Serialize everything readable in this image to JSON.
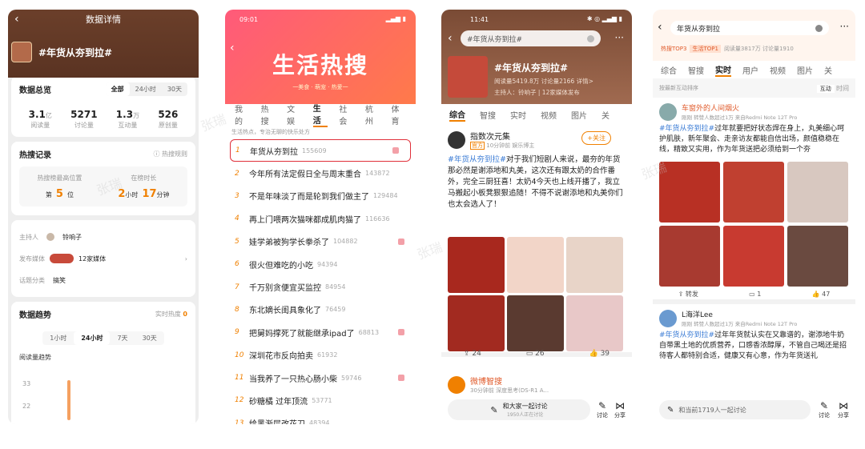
{
  "panel1": {
    "title": "数据详情",
    "topic": "#年货从夯到拉#",
    "overview": {
      "label": "数据总览",
      "segments": [
        "全部",
        "24小时",
        "30天"
      ],
      "stats": [
        {
          "value": "3.1",
          "unit": "亿",
          "label": "阅读量"
        },
        {
          "value": "5271",
          "unit": "",
          "label": "讨论量"
        },
        {
          "value": "1.3",
          "unit": "万",
          "label": "互动量"
        },
        {
          "value": "526",
          "unit": "",
          "label": "原创量"
        }
      ]
    },
    "hot_record": {
      "label": "热搜记录",
      "rule": "热搜规则",
      "rank_label": "热搜榜最高位置",
      "rank_prefix": "第",
      "rank_value": "5",
      "rank_suffix": "位",
      "duration_label": "在榜时长",
      "hours": "2",
      "hours_unit": "小时",
      "minutes": "17",
      "minutes_unit": "分钟"
    },
    "host_label": "主持人",
    "host_name": "铃响子",
    "media_label": "发布媒体",
    "media_value": "12家媒体",
    "category_label": "话题分类",
    "category_value": "搞笑",
    "trend": {
      "label": "数据趋势",
      "realtime": "实时热度",
      "realtime_value": "0",
      "segments": [
        "1小时",
        "24小时",
        "7天",
        "30天"
      ],
      "chart_label": "阅读量趋势",
      "y_ticks": [
        "33",
        "22"
      ]
    }
  },
  "panel2": {
    "time": "09:01",
    "banner_title": "生活热搜",
    "banner_sub": "一美食 · 萌宠 · 热爱一",
    "tabs": [
      "我的",
      "热搜",
      "文娱",
      "生活",
      "社会",
      "杭州",
      "体育"
    ],
    "active_tab": 3,
    "subtitle": "生活热点，专治无聊的快乐处方",
    "items": [
      {
        "rank": "1",
        "title": "年货从夯到拉",
        "heat": "155609",
        "tag": true
      },
      {
        "rank": "2",
        "title": "今年所有法定假日全与周末重合",
        "heat": "143872",
        "tag": false
      },
      {
        "rank": "3",
        "title": "不是年味淡了而是轮到我们做主了",
        "heat": "129484",
        "tag": false
      },
      {
        "rank": "4",
        "title": "再上门喂两次猫咪都成肌肉猫了",
        "heat": "116636",
        "tag": false
      },
      {
        "rank": "5",
        "title": "娃学弟被狗学长拳杀了",
        "heat": "104882",
        "tag": true
      },
      {
        "rank": "6",
        "title": "很火但难吃的小吃",
        "heat": "94394",
        "tag": false
      },
      {
        "rank": "7",
        "title": "千万别贪便宜买监控",
        "heat": "84954",
        "tag": false
      },
      {
        "rank": "8",
        "title": "东北嫡长闺具象化了",
        "heat": "76459",
        "tag": false
      },
      {
        "rank": "9",
        "title": "把舅妈撑死了就能继承ipad了",
        "heat": "68813",
        "tag": true
      },
      {
        "rank": "10",
        "title": "深圳花市反向拍卖",
        "heat": "61932",
        "tag": false
      },
      {
        "rank": "11",
        "title": "当我养了一只热心肠小柴",
        "heat": "59746",
        "tag": true
      },
      {
        "rank": "12",
        "title": "砂糖橘 过年顶流",
        "heat": "53771",
        "tag": false
      },
      {
        "rank": "13",
        "title": "给黑渐层改花刀",
        "heat": "48394",
        "tag": false
      }
    ]
  },
  "panel3": {
    "time": "11:41",
    "search_value": "#年货从夯到拉#",
    "topic": "#年货从夯到拉#",
    "meta1": "阅读量5419.8万  讨论量2166  详情>",
    "meta2": "主持人：铃响子 | 12家媒体发布",
    "tabs": [
      "综合",
      "智搜",
      "实时",
      "视频",
      "图片",
      "关"
    ],
    "author": "指数次元集",
    "author_badge": "官方",
    "post_meta": "10分钟前 娱乐博主",
    "follow": "+关注",
    "post_tag": "#年货从夯到拉#",
    "post_body": "对于我们短剧人来说，最夯的年货那必然是谢添地和丸美，这次还有跟太奶的合作番外，完全三厨狂喜！太奶4今天也上线开播了，我立马搬起小板凳狠狠追随！不得不说谢添地和丸美你们也太会选人了！",
    "reposts": "24",
    "comments": "26",
    "likes": "39",
    "second_author": "微博智搜",
    "second_meta": "30分钟前 深度思考(DS-R1 A...",
    "discuss_cta": "和大家一起讨论",
    "discuss_sub": "1950人正在讨论",
    "discuss_label": "讨论",
    "share_label": "分享"
  },
  "panel4": {
    "search_value": "年货从夯到拉",
    "hot_rank": "热搜TOP3",
    "life_rank": "生活TOP1",
    "read_meta": "阅读量3817万  讨论量1910",
    "tabs": [
      "综合",
      "智搜",
      "实时",
      "用户",
      "视频",
      "图片",
      "关"
    ],
    "active_tab": 2,
    "sort_label": "按最新互动排序",
    "sort_opts": [
      "互动",
      "时间"
    ],
    "author": "车窗外的人间烟火",
    "post_meta": "刚刚 转赞人数超过1万 来自Redmi Note 12T Pro",
    "post_tag": "#年货从夯到拉#",
    "post_body": "过年就要把好状态焊在身上，丸美细心呵护肌肤，新年聚会、走亲访友都能自信出场，颜值稳稳在线，精致又实用，作为年货送把必须给到一个夯",
    "reposts": "转发",
    "comments": "1",
    "likes": "47",
    "author2": "L海洋Lee",
    "post2_meta": "刚刚 转赞人数超过1万 来自Redmi Note 12T Pro",
    "post2_tag": "#年货从夯到拉#",
    "post2_body": "过年年货就认实在又靠谱的，谢添地牛奶自带黑土地的优质营养，口感香浓醇厚，不管自己喝还是招待客人都特别合适，健康又有心意，作为年货送礼",
    "discuss_placeholder": "和当前1719人一起讨论",
    "discuss_label": "讨论",
    "share_label": "分享"
  },
  "watermark": "张瑞"
}
